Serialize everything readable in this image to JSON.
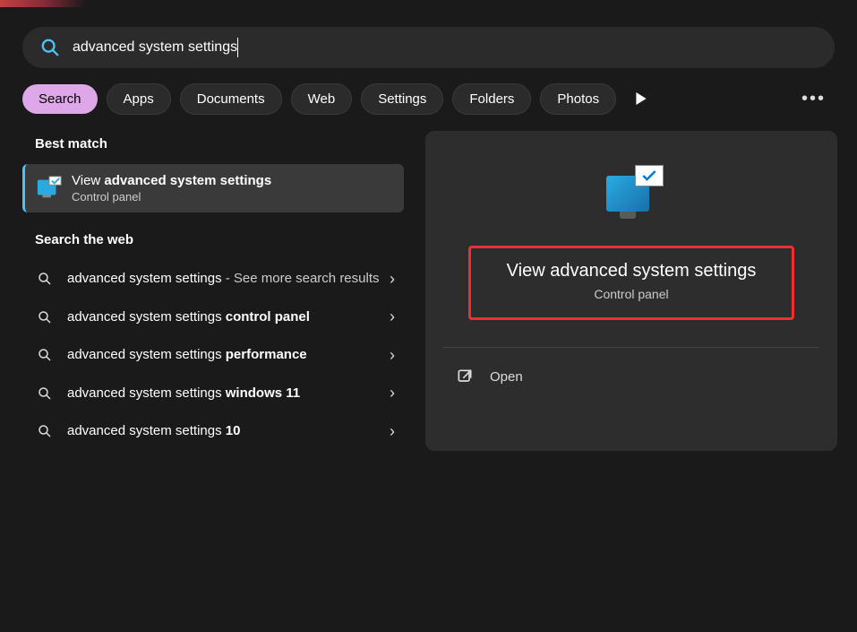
{
  "search": {
    "value": "advanced system settings"
  },
  "tabs": {
    "items": [
      "Search",
      "Apps",
      "Documents",
      "Web",
      "Settings",
      "Folders",
      "Photos"
    ]
  },
  "left": {
    "bestMatchHeader": "Best match",
    "best": {
      "prefix": "View ",
      "bold": "advanced system settings",
      "sub": "Control panel"
    },
    "webHeader": "Search the web",
    "items": [
      {
        "main": "advanced system settings",
        "bold": "",
        "suffix": " - See more search results"
      },
      {
        "main": "advanced system settings ",
        "bold": "control panel",
        "suffix": ""
      },
      {
        "main": "advanced system settings ",
        "bold": "performance",
        "suffix": ""
      },
      {
        "main": "advanced system settings ",
        "bold": "windows 11",
        "suffix": ""
      },
      {
        "main": "advanced system settings ",
        "bold": "10",
        "suffix": ""
      }
    ]
  },
  "right": {
    "title": "View advanced system settings",
    "sub": "Control panel",
    "open": "Open"
  }
}
